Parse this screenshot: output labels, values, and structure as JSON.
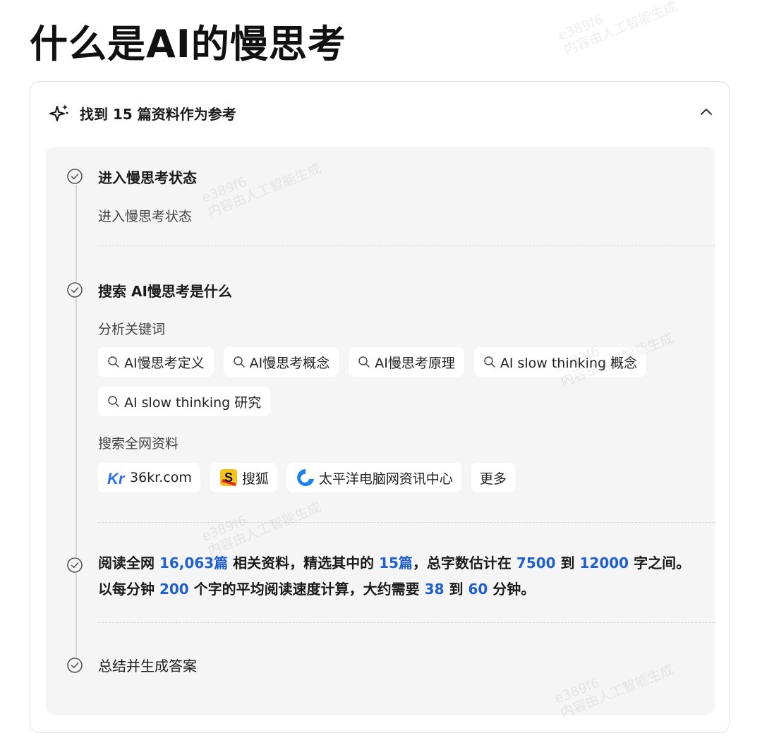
{
  "page": {
    "title": "什么是AI的慢思考"
  },
  "card": {
    "header_text": "找到 15 篇资料作为参考"
  },
  "steps": {
    "step1": {
      "title": "进入慢思考状态",
      "detail": "进入慢思考状态"
    },
    "step2": {
      "title": "搜索 AI慢思考是什么",
      "keywords_label": "分析关键词",
      "keywords": [
        "AI慢思考定义",
        "AI慢思考概念",
        "AI慢思考原理",
        "AI slow thinking 概念",
        "AI slow thinking 研究"
      ],
      "sources_label": "搜索全网资料",
      "sources": [
        {
          "name": "36kr.com",
          "logo": "36kr-logo",
          "logo_text": "Kr"
        },
        {
          "name": "搜狐",
          "logo": "sohu-logo",
          "logo_text": "S"
        },
        {
          "name": "太平洋电脑网资讯中心",
          "logo": "pconline-logo"
        }
      ],
      "more_label": "更多"
    },
    "step3": {
      "p1": "阅读全网 ",
      "total_docs": "16,063篇",
      "p2": " 相关资料，精选其中的 ",
      "selected_docs": "15篇",
      "p3": "，总字数估计在 ",
      "min_words": "7500",
      "p4": " 到 ",
      "max_words": "12000",
      "p5": " 字之间。 以每分钟 ",
      "speed": "200",
      "p6": " 个字的平均阅读速度计算，大约需要 ",
      "min_minutes": "38",
      "p7": " 到 ",
      "max_minutes": "60",
      "p8": " 分钟。"
    },
    "step4": {
      "title": "总结并生成答案"
    }
  },
  "watermark": {
    "line1": "e389f6",
    "line2": "内容由人工智能生成"
  },
  "colors": {
    "highlight": "#1f5fd0",
    "panel_bg": "#f5f5f6",
    "border": "#e2e2e2"
  }
}
